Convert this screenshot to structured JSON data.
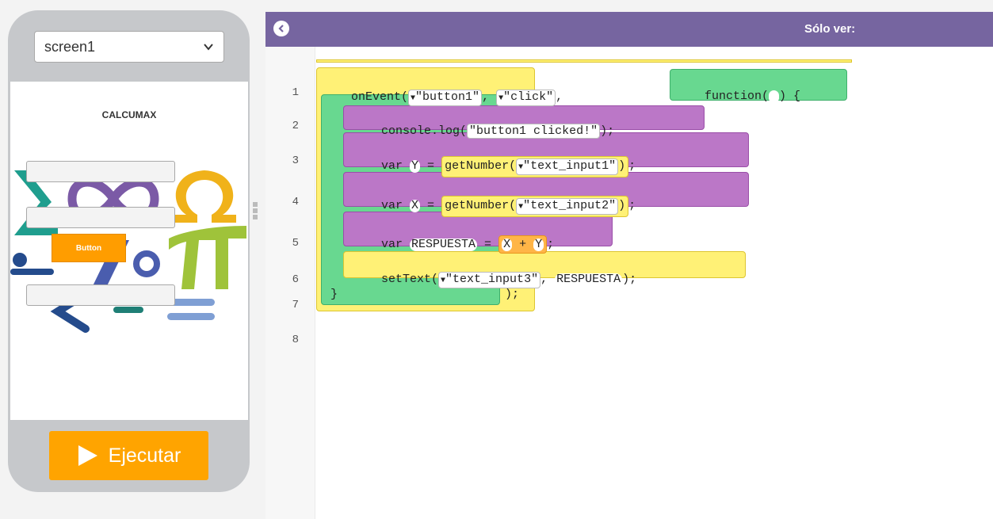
{
  "sidebar": {
    "screen_select": "screen1",
    "app": {
      "title": "CALCUMAX",
      "button_label": "Button"
    },
    "run_label": "Ejecutar"
  },
  "workspace": {
    "header": {
      "readonly_label": "Sólo ver:"
    },
    "line_numbers": [
      "1",
      "2",
      "3",
      "4",
      "5",
      "6",
      "7",
      "8"
    ],
    "code": {
      "l1": {
        "fn": "onEvent(",
        "arg1": "\"button1\"",
        "comma1": ", ",
        "arg2": "\"click\"",
        "comma2": ",",
        "func": "function(",
        "func_end": ") {"
      },
      "l2": {
        "pre": "console.log(",
        "str": "\"button1 clicked!\"",
        "post": ");"
      },
      "l3": {
        "kw": "var ",
        "var": "Y",
        "eq": " = ",
        "call": "getNumber(",
        "arg": "\"text_input1\"",
        "close": ")",
        "semi": ";"
      },
      "l4": {
        "kw": "var ",
        "var": "X",
        "eq": " = ",
        "call": "getNumber(",
        "arg": "\"text_input2\"",
        "close": ")",
        "semi": ";"
      },
      "l5": {
        "kw": "var ",
        "var": "RESPUESTA",
        "eq": " = ",
        "a": "X",
        "op": " + ",
        "b": "Y",
        "semi": ";"
      },
      "l6": {
        "pre": "setText(",
        "arg": "\"text_input3\"",
        "comma": ", ",
        "var": "RESPUESTA",
        "post": ");"
      },
      "l7": {
        "brace": "}",
        "post": ");"
      }
    }
  },
  "colors": {
    "header": "#7665a0",
    "run_button": "#ffa400",
    "event_block": "#fff176",
    "function_block": "#68d890",
    "statement_block": "#bb77c7"
  }
}
